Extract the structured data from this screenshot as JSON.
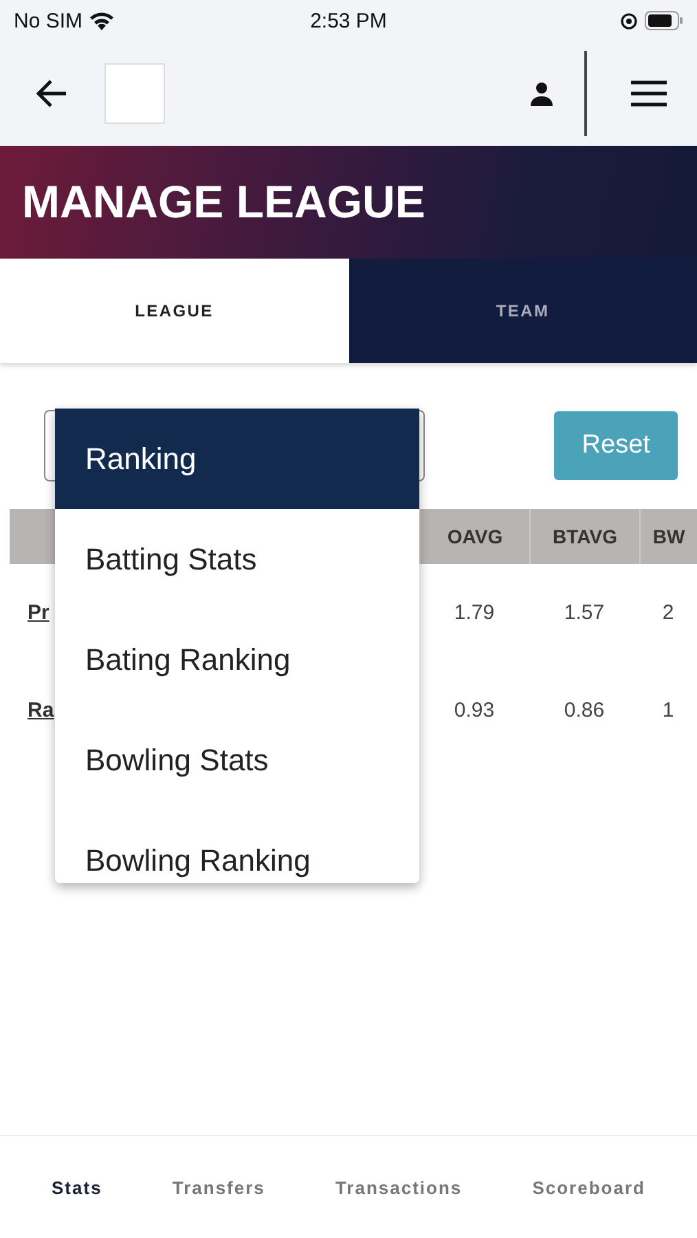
{
  "status_bar": {
    "carrier": "No SIM",
    "time": "2:53 PM"
  },
  "page_title": "MANAGE LEAGUE",
  "tabs": [
    {
      "label": "LEAGUE",
      "selected": true
    },
    {
      "label": "TEAM",
      "selected": false
    }
  ],
  "reset_button": "Reset",
  "table": {
    "columns": [
      "OAVG",
      "BTAVG",
      "BW"
    ],
    "rows": [
      {
        "name": "Pr",
        "cells": [
          "1.79",
          "1.57",
          "2"
        ]
      },
      {
        "name": "Ra",
        "cells": [
          "0.93",
          "0.86",
          "1"
        ]
      }
    ]
  },
  "dropdown": {
    "options": [
      {
        "label": "Ranking",
        "selected": true
      },
      {
        "label": "Batting Stats",
        "selected": false
      },
      {
        "label": "Bating Ranking",
        "selected": false
      },
      {
        "label": "Bowling Stats",
        "selected": false
      },
      {
        "label": "Bowling Ranking",
        "selected": false
      }
    ]
  },
  "bottom_nav": [
    {
      "label": "Stats",
      "selected": true
    },
    {
      "label": "Transfers",
      "selected": false
    },
    {
      "label": "Transactions",
      "selected": false
    },
    {
      "label": "Scoreboard",
      "selected": false
    }
  ]
}
